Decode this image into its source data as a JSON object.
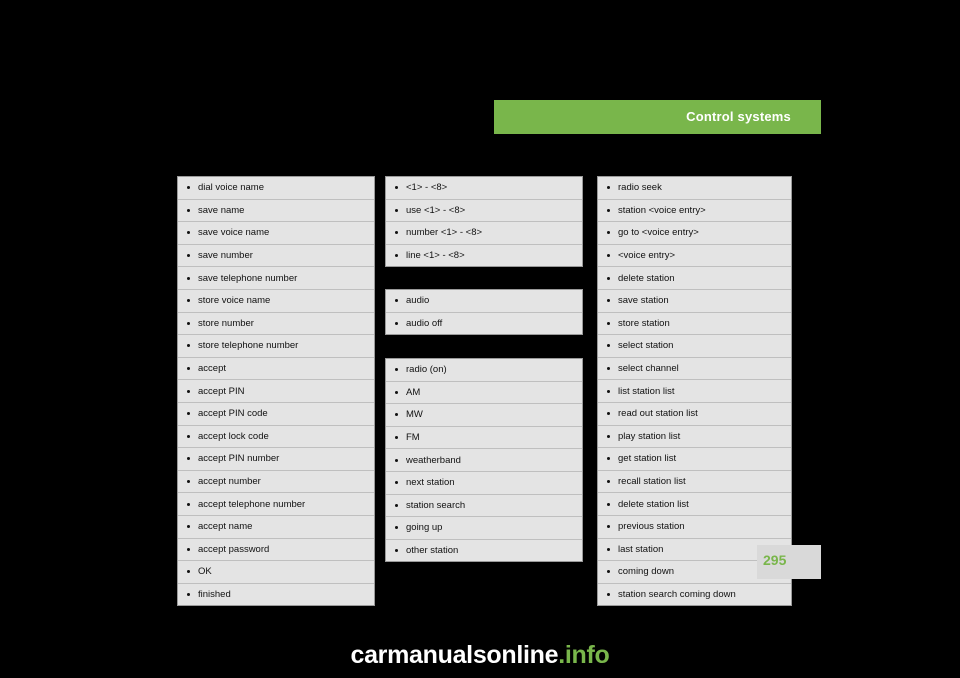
{
  "header": {
    "title": "Control systems"
  },
  "page_number": "295",
  "footer": {
    "watermark_main": "carmanualsonline",
    "watermark_suffix": ".info"
  },
  "columns": [
    {
      "id": "column-1",
      "groups": [
        {
          "id": "group-phone-commands",
          "items": [
            "dial voice name",
            "save name",
            "save voice name",
            "save number",
            "save telephone number",
            "store voice name",
            "store number",
            "store telephone number",
            "accept",
            "accept PIN",
            "accept PIN code",
            "accept lock code",
            "accept PIN number",
            "accept number",
            "accept telephone number",
            "accept name",
            "accept password",
            "OK",
            "finished"
          ]
        }
      ]
    },
    {
      "id": "column-2",
      "groups": [
        {
          "id": "group-digits",
          "items": [
            "<1> - <8>",
            "use <1> - <8>",
            "number <1> - <8>",
            "line <1> - <8>"
          ]
        },
        {
          "id": "group-audio",
          "items": [
            "audio",
            "audio off"
          ]
        },
        {
          "id": "group-radio",
          "items": [
            "radio (on)",
            "AM",
            "MW",
            "FM",
            "weatherband",
            "next station",
            "station search",
            "going up",
            "other station"
          ]
        }
      ]
    },
    {
      "id": "column-3",
      "groups": [
        {
          "id": "group-station",
          "items": [
            "radio seek",
            "station <voice entry>",
            "go to <voice entry>",
            "<voice entry>",
            "delete station",
            "save station",
            "store station",
            "select station",
            "select channel",
            "list station list",
            "read out station list",
            "play station list",
            "get station list",
            "recall station list",
            "delete station list",
            "previous station",
            "last station",
            "coming down",
            "station search coming down"
          ]
        }
      ]
    }
  ]
}
